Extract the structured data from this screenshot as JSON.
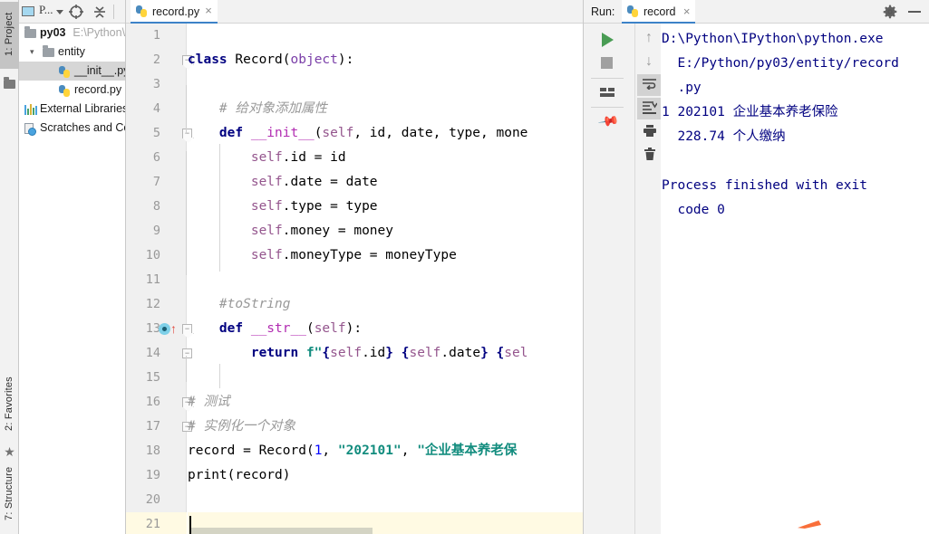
{
  "left_strip": {
    "tabs": [
      {
        "label": "1: Project",
        "active": true
      },
      {
        "label": "2: Favorites",
        "active": false
      },
      {
        "label": "7: Structure",
        "active": false
      }
    ]
  },
  "project_panel": {
    "toolbar": {
      "project_selector_label": "P...",
      "target_icon": "crosshair-icon",
      "collapse_icon": "collapse-all-icon"
    },
    "tree": [
      {
        "label": "py03",
        "path": "E:\\Python\\p",
        "kind": "folder",
        "bold": true,
        "indent": 6,
        "arrow": "",
        "selected": false
      },
      {
        "label": "entity",
        "path": "",
        "kind": "folder",
        "bold": false,
        "indent": 26,
        "arrow": "v",
        "selected": false
      },
      {
        "label": "__init__.py",
        "path": "",
        "kind": "python",
        "bold": false,
        "indent": 44,
        "arrow": "",
        "selected": true
      },
      {
        "label": "record.py",
        "path": "",
        "kind": "python",
        "bold": false,
        "indent": 44,
        "arrow": "",
        "selected": false
      },
      {
        "label": "External Libraries",
        "path": "",
        "kind": "library",
        "bold": false,
        "indent": 6,
        "arrow": "",
        "selected": false
      },
      {
        "label": "Scratches and Co",
        "path": "",
        "kind": "scratch",
        "bold": false,
        "indent": 6,
        "arrow": "",
        "selected": false
      }
    ]
  },
  "editor": {
    "tab_label": "record.py",
    "tab_close": "×",
    "lines": [
      {
        "n": "1",
        "segs": []
      },
      {
        "n": "2",
        "segs": [
          {
            "t": "class ",
            "c": "kw"
          },
          {
            "t": "Record",
            "c": "cls"
          },
          {
            "t": "(",
            "c": "param"
          },
          {
            "t": "object",
            "c": "builtin"
          },
          {
            "t": "):",
            "c": "param"
          }
        ],
        "indent": 0
      },
      {
        "n": "3",
        "segs": []
      },
      {
        "n": "4",
        "segs": [
          {
            "t": "# 给对象添加属性",
            "c": "cmt"
          }
        ],
        "indent": 4
      },
      {
        "n": "5",
        "segs": [
          {
            "t": "def ",
            "c": "kw"
          },
          {
            "t": "__init__",
            "c": "fname"
          },
          {
            "t": "(",
            "c": "param"
          },
          {
            "t": "self",
            "c": "selfc"
          },
          {
            "t": ", id, date, type, mone",
            "c": "param"
          }
        ],
        "indent": 4
      },
      {
        "n": "6",
        "segs": [
          {
            "t": "self",
            "c": "selfc"
          },
          {
            "t": ".id = id",
            "c": "param"
          }
        ],
        "indent": 8
      },
      {
        "n": "7",
        "segs": [
          {
            "t": "self",
            "c": "selfc"
          },
          {
            "t": ".date = date",
            "c": "param"
          }
        ],
        "indent": 8
      },
      {
        "n": "8",
        "segs": [
          {
            "t": "self",
            "c": "selfc"
          },
          {
            "t": ".type = type",
            "c": "param"
          }
        ],
        "indent": 8
      },
      {
        "n": "9",
        "segs": [
          {
            "t": "self",
            "c": "selfc"
          },
          {
            "t": ".money = money",
            "c": "param"
          }
        ],
        "indent": 8
      },
      {
        "n": "10",
        "segs": [
          {
            "t": "self",
            "c": "selfc"
          },
          {
            "t": ".moneyType = moneyType",
            "c": "param"
          }
        ],
        "indent": 8
      },
      {
        "n": "11",
        "segs": []
      },
      {
        "n": "12",
        "segs": [
          {
            "t": "#toString",
            "c": "cmt"
          }
        ],
        "indent": 4
      },
      {
        "n": "13",
        "segs": [
          {
            "t": "def ",
            "c": "kw"
          },
          {
            "t": "__str__",
            "c": "fname"
          },
          {
            "t": "(",
            "c": "param"
          },
          {
            "t": "self",
            "c": "selfc"
          },
          {
            "t": "):",
            "c": "param"
          }
        ],
        "indent": 4
      },
      {
        "n": "14",
        "segs": [
          {
            "t": "return ",
            "c": "kw"
          },
          {
            "t": "f\"",
            "c": "fpfx"
          },
          {
            "t": "{",
            "c": "brace"
          },
          {
            "t": "self",
            "c": "selfc"
          },
          {
            "t": ".id",
            "c": "param"
          },
          {
            "t": "}",
            "c": "brace"
          },
          {
            "t": " ",
            "c": "param"
          },
          {
            "t": "{",
            "c": "brace"
          },
          {
            "t": "self",
            "c": "selfc"
          },
          {
            "t": ".date",
            "c": "param"
          },
          {
            "t": "}",
            "c": "brace"
          },
          {
            "t": " ",
            "c": "param"
          },
          {
            "t": "{",
            "c": "brace"
          },
          {
            "t": "sel",
            "c": "selfc"
          }
        ],
        "indent": 8
      },
      {
        "n": "15",
        "segs": []
      },
      {
        "n": "16",
        "segs": [
          {
            "t": "# 测试",
            "c": "cmt"
          }
        ],
        "indent": 0
      },
      {
        "n": "17",
        "segs": [
          {
            "t": "# 实例化一个对象",
            "c": "cmt"
          }
        ],
        "indent": 0
      },
      {
        "n": "18",
        "segs": [
          {
            "t": "record = Record(",
            "c": "param"
          },
          {
            "t": "1",
            "c": "num"
          },
          {
            "t": ", ",
            "c": "param"
          },
          {
            "t": "\"202101\"",
            "c": "str"
          },
          {
            "t": ", ",
            "c": "param"
          },
          {
            "t": "\"企业基本养老保",
            "c": "str"
          }
        ],
        "indent": 0
      },
      {
        "n": "19",
        "segs": [
          {
            "t": "print(record)",
            "c": "param"
          }
        ],
        "indent": 0
      },
      {
        "n": "20",
        "segs": []
      },
      {
        "n": "21",
        "segs": [],
        "highlight": true,
        "caret": true
      }
    ]
  },
  "run_panel": {
    "title": "Run:",
    "tab_label": "record",
    "tab_close": "×",
    "gear_icon": "gear-icon",
    "minimize_icon": "minimize-icon",
    "toolbar_left": [
      {
        "name": "run-button",
        "icon": "play-icon"
      },
      {
        "name": "stop-button",
        "icon": "stop-icon"
      },
      {
        "name": "layout-button",
        "icon": "grid-icon"
      },
      {
        "name": "pin-tab-button",
        "icon": "pin-icon"
      }
    ],
    "toolbar_right": [
      {
        "name": "up-the-stack-trace-button",
        "icon": "arrow-up-icon",
        "active": false
      },
      {
        "name": "down-the-stack-trace-button",
        "icon": "arrow-down-icon",
        "active": false
      },
      {
        "name": "soft-wrap-button",
        "icon": "soft-wrap-icon",
        "active": true
      },
      {
        "name": "scroll-to-end-button",
        "icon": "scroll-to-end-icon",
        "active": true
      },
      {
        "name": "print-button",
        "icon": "print-icon",
        "active": false
      },
      {
        "name": "clear-all-button",
        "icon": "trash-icon",
        "active": false
      }
    ],
    "console_lines": [
      "D:\\Python\\IPython\\python.exe",
      "  E:/Python/py03/entity/record",
      "  .py",
      "1 202101 企业基本养老保险",
      "  228.74 个人缴纳",
      "",
      "Process finished with exit",
      "  code 0"
    ]
  },
  "colors": {
    "accent": "#3c82c8",
    "keyword": "#000080",
    "string": "#128c7e",
    "comment": "#999999",
    "self": "#94558d",
    "function": "#b12bb1",
    "builtin": "#7a3ea8",
    "number": "#0000ff",
    "console_text": "#000080",
    "run_green": "#499c54",
    "highlight_row": "#fffae3"
  }
}
